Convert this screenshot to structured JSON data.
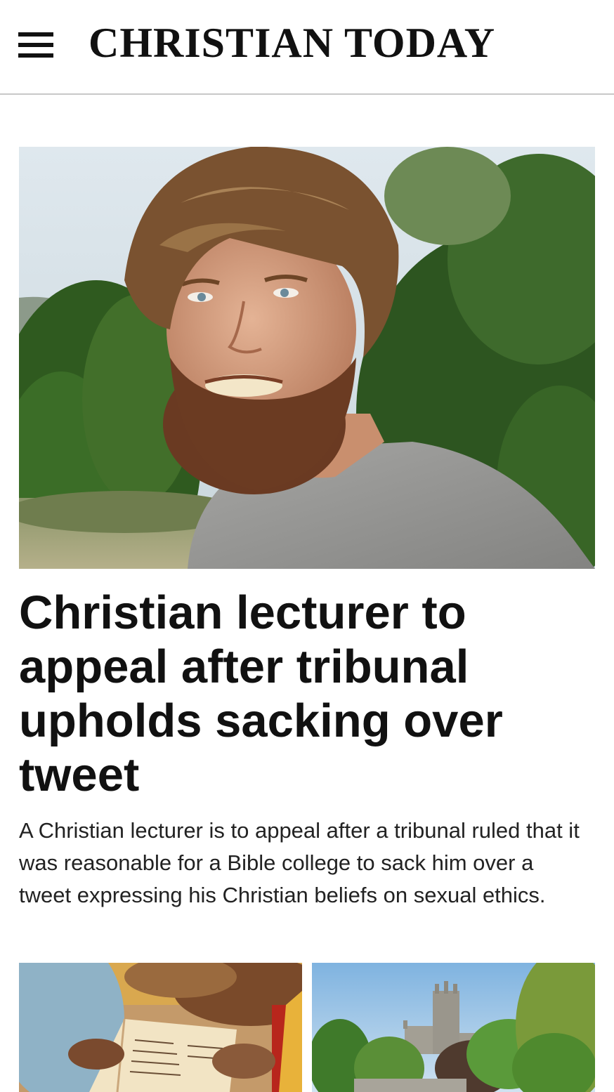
{
  "header": {
    "site_name": "CHRISTIAN TODAY",
    "menu_icon": "hamburger-menu-icon"
  },
  "lead_story": {
    "headline": "Christian lecturer to appeal after tribunal upholds sacking over tweet",
    "summary": "A Christian lecturer is to appeal after a tribunal ruled that it was reasonable for a Bible college to sack him over a tweet expressing his Christian beliefs on sexual ethics.",
    "image": "photo of a bearded man in a grey t-shirt outdoors"
  },
  "secondary_stories": [
    {
      "image": "photo of hands holding an open book"
    },
    {
      "image": "photo of a cathedral tower behind trees"
    }
  ],
  "colors": {
    "text": "#111111",
    "divider": "#c8c8c8",
    "background": "#ffffff"
  }
}
